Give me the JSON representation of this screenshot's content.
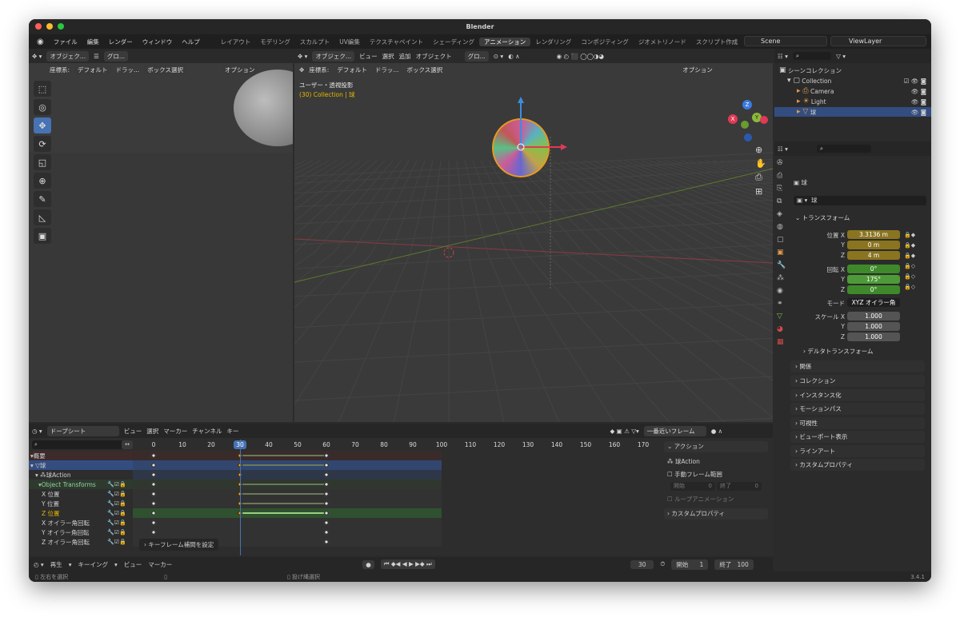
{
  "app": {
    "title": "Blender",
    "version": "3.4.1"
  },
  "menu": {
    "items": [
      "ファイル",
      "編集",
      "レンダー",
      "ウィンドウ",
      "ヘルプ"
    ]
  },
  "workspaces": {
    "items": [
      "レイアウト",
      "モデリング",
      "スカルプト",
      "UV編集",
      "テクスチャペイント",
      "シェーディング",
      "アニメーション",
      "レンダリング",
      "コンポジティング",
      "ジオメトリノード",
      "スクリプト作成"
    ],
    "active": "アニメーション"
  },
  "scene": {
    "name": "Scene",
    "view_layer": "ViewLayer"
  },
  "left_view": {
    "header": {
      "mode": "オブジェク...",
      "transform": "グロ..."
    },
    "header2": {
      "coord_label": "座標系:",
      "coord": "デフォルト",
      "drag": "ドラッ...",
      "select": "ボックス選択",
      "options": "オプション"
    }
  },
  "main_view": {
    "header": {
      "mode": "オブジェク...",
      "menu": [
        "ビュー",
        "選択",
        "追加",
        "オブジェクト"
      ],
      "transform": "グロ..."
    },
    "header2": {
      "coord_label": "座標系:",
      "coord": "デフォルト",
      "drag": "ドラッ...",
      "select": "ボックス選択",
      "options": "オプション"
    },
    "overlay_title": "ユーザー・透視投影",
    "overlay_sub": "(30) Collection | 球",
    "gizmo": {
      "x": "X",
      "y": "Y",
      "z": "Z"
    }
  },
  "outliner": {
    "root": "シーンコレクション",
    "rows": [
      {
        "label": "Collection"
      },
      {
        "label": "Camera"
      },
      {
        "label": "Light"
      },
      {
        "label": "球"
      }
    ]
  },
  "properties": {
    "object_name": "球",
    "object_field": "球",
    "transform_title": "トランスフォーム",
    "location": {
      "label": "位置 X",
      "x": "3.3136 m",
      "y_label": "Y",
      "y": "0 m",
      "z_label": "Z",
      "z": "4 m"
    },
    "rotation": {
      "label": "回転 X",
      "x": "0°",
      "y_label": "Y",
      "y": "175°",
      "z_label": "Z",
      "z": "0°"
    },
    "mode": {
      "label": "モード",
      "value": "XYZ オイラー角"
    },
    "scale": {
      "label": "スケール X",
      "x": "1.000",
      "y_label": "Y",
      "y": "1.000",
      "z_label": "Z",
      "z": "1.000"
    },
    "delta": "デルタトランスフォーム",
    "panels": [
      "関係",
      "コレクション",
      "インスタンス化",
      "モーションパス",
      "可視性",
      "ビューポート表示",
      "ラインアート",
      "カスタムプロパティ"
    ]
  },
  "dopesheet": {
    "mode": "ドープシート",
    "menu": [
      "ビュー",
      "選択",
      "マーカー",
      "チャンネル",
      "キー"
    ],
    "snap": "一番近いフレーム",
    "ticks": [
      "0",
      "10",
      "20",
      "30",
      "40",
      "50",
      "60",
      "70",
      "80",
      "90",
      "100",
      "110",
      "120",
      "130",
      "140",
      "150",
      "160",
      "170"
    ],
    "current_frame": "30",
    "channels": [
      {
        "label": "概要"
      },
      {
        "label": "球"
      },
      {
        "label": "球Action"
      },
      {
        "label": "Object Transforms"
      },
      {
        "label": "X 位置"
      },
      {
        "label": "Y 位置"
      },
      {
        "label": "Z 位置"
      },
      {
        "label": "X オイラー角回転"
      },
      {
        "label": "Y オイラー角回転"
      },
      {
        "label": "Z オイラー角回転"
      }
    ],
    "keyframe_frames": [
      0,
      30,
      60
    ],
    "popup": "キーフレーム補間を設定",
    "action_panel": {
      "title": "アクション",
      "name": "球Action",
      "manual_range": "手動フレーム範囲",
      "start_label": "開始",
      "start": "0",
      "end_label": "終了",
      "end": "0",
      "loop": "ループアニメーション",
      "custom": "カスタムプロパティ"
    }
  },
  "timeline": {
    "menu": [
      "再生",
      "キーイング",
      "ビュー",
      "マーカー"
    ],
    "frame": "30",
    "start_label": "開始",
    "start": "1",
    "end_label": "終了",
    "end": "100"
  },
  "statusbar": {
    "left": "左右を選択",
    "mid": "投げ縄選択",
    "version": "3.4.1"
  },
  "colors": {
    "accent": "#4772b3",
    "selected_row": "#334d80",
    "z_pos_row": "#2f5a2f",
    "loc_field": "#8a7420",
    "rot_field": "#3e8a2a",
    "playhead": "#4772b3"
  }
}
